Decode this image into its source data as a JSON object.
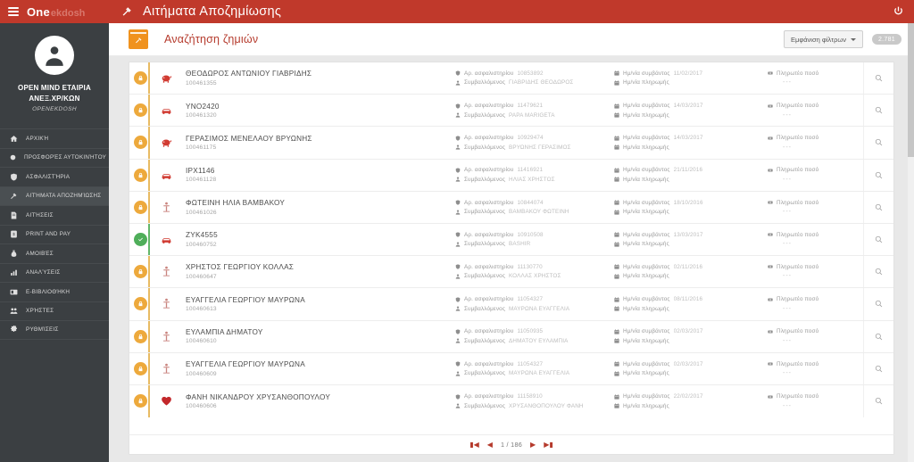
{
  "topbar": {
    "brand_main": "One",
    "brand_sub": "ekdosh",
    "menu_icon": "hamburger-icon",
    "title_icon": "gavel-icon",
    "title": "Αιτήματα Αποζημίωσης",
    "power_icon": "power-icon"
  },
  "sidebar": {
    "avatar_icon": "user-avatar-icon",
    "org_name": "OPEN MIND ΕΤΑΙΡΙΑ ΑΝΕΞ.ΧΡ/ΚΩΝ",
    "org_sub": "OPENEKDOSH",
    "items": [
      {
        "label": "Αρχική",
        "icon": "home-icon",
        "active": false
      },
      {
        "label": "Προσφορές Αυτοκινήτου",
        "icon": "circle-icon",
        "active": false
      },
      {
        "label": "Ασφαλιστήρια",
        "icon": "shield-icon",
        "active": false
      },
      {
        "label": "Αιτήματα Αποζημίωσης",
        "icon": "gavel-icon",
        "active": true
      },
      {
        "label": "Αιτήσεις",
        "icon": "document-icon",
        "active": false
      },
      {
        "label": "Print and Pay",
        "icon": "print-pay-icon",
        "active": false
      },
      {
        "label": "Αμοιβές",
        "icon": "money-bag-icon",
        "active": false
      },
      {
        "label": "Αναλύσεις",
        "icon": "chart-icon",
        "active": false
      },
      {
        "label": "e-Βιβλιοθήκη",
        "icon": "library-icon",
        "active": false
      },
      {
        "label": "Χρήστες",
        "icon": "users-icon",
        "active": false
      },
      {
        "label": "Ρυθμίσεις",
        "icon": "gear-icon",
        "active": false
      }
    ]
  },
  "page": {
    "icon": "claim-box-icon",
    "title": "Αναζήτηση ζημιών",
    "filter_button": "Εμφάνιση φίλτρων",
    "filter_caret_icon": "chevron-down-icon",
    "result_count": "2.781"
  },
  "labels": {
    "policy": "Αρ. ασφαλιστηρίου",
    "contractor": "Συμβαλλόμενος",
    "event_date": "Ημ/νία συμβάντος",
    "payment_date": "Ημ/νία πληρωμής",
    "paid_amount": "Πληρωτέο ποσό",
    "empty_value": "---",
    "policy_icon": "shield-icon",
    "contractor_icon": "person-icon",
    "date_icon": "calendar-icon",
    "amount_icon": "money-icon",
    "zoom_icon": "magnifier-icon"
  },
  "rows": [
    {
      "status": "pending",
      "status_icon": "lock-icon",
      "type_icon": "piggy-bank-icon",
      "name": "ΘΕΟΔΩΡΟΣ ΑΝΤΩΝΙΟΥ ΓΙΑΒΡΙΔΗΣ",
      "claim_id": "100461355",
      "policy": "10853892",
      "contractor": "ΓΙΑΒΡΙΔΗΣ ΘΕΟΔΩΡΟΣ",
      "event_date": "11/02/2017",
      "payment_date": "",
      "amount": "---"
    },
    {
      "status": "pending",
      "status_icon": "lock-icon",
      "type_icon": "car-icon",
      "name": "ΥΝΟ2420",
      "claim_id": "100461320",
      "policy": "11479621",
      "contractor": "PAPA MARIGETA",
      "event_date": "14/03/2017",
      "payment_date": "",
      "amount": "---"
    },
    {
      "status": "pending",
      "status_icon": "lock-icon",
      "type_icon": "piggy-bank-icon",
      "name": "ΓΕΡΑΣΙΜΟΣ ΜΕΝΕΛΑΟΥ ΒΡΥΩΝΗΣ",
      "claim_id": "100461175",
      "policy": "10929474",
      "contractor": "ΒΡΥΩΝΗΣ ΓΕΡΑΣΙΜΟΣ",
      "event_date": "14/03/2017",
      "payment_date": "",
      "amount": "---"
    },
    {
      "status": "pending",
      "status_icon": "lock-icon",
      "type_icon": "car-icon",
      "name": "ΙΡΧ1146",
      "claim_id": "100461128",
      "policy": "11416921",
      "contractor": "ΗΛΙΑΣ ΧΡΗΣΤΟΣ",
      "event_date": "21/11/2016",
      "payment_date": "",
      "amount": "---"
    },
    {
      "status": "pending",
      "status_icon": "lock-icon",
      "type_icon": "person-health-icon",
      "name": "ΦΩΤΕΙΝΗ ΗΛΙΑ ΒΑΜΒΑΚΟΥ",
      "claim_id": "100461026",
      "policy": "10844074",
      "contractor": "ΒΑΜΒΑΚΟΥ ΦΩΤΕΙΝΗ",
      "event_date": "18/10/2016",
      "payment_date": "",
      "amount": "---"
    },
    {
      "status": "done",
      "status_icon": "check-icon",
      "type_icon": "car-icon",
      "name": "ΖΥΚ4555",
      "claim_id": "100460752",
      "policy": "10910508",
      "contractor": "BASHIR",
      "event_date": "13/03/2017",
      "payment_date": "",
      "amount": "---"
    },
    {
      "status": "pending",
      "status_icon": "lock-icon",
      "type_icon": "person-health-icon",
      "name": "ΧΡΗΣΤΟΣ ΓΕΩΡΓΙΟΥ ΚΟΛΛΑΣ",
      "claim_id": "100460647",
      "policy": "11130770",
      "contractor": "ΚΟΛΛΑΣ ΧΡΗΣΤΟΣ",
      "event_date": "02/11/2016",
      "payment_date": "",
      "amount": "---"
    },
    {
      "status": "pending",
      "status_icon": "lock-icon",
      "type_icon": "person-health-icon",
      "name": "ΕΥΑΓΓΕΛΙΑ ΓΕΩΡΓΙΟΥ ΜΑΥΡΩΝΑ",
      "claim_id": "100460613",
      "policy": "11054327",
      "contractor": "ΜΑΥΡΩΝΑ ΕΥΑΓΓΕΛΙΑ",
      "event_date": "08/11/2016",
      "payment_date": "",
      "amount": "---"
    },
    {
      "status": "pending",
      "status_icon": "lock-icon",
      "type_icon": "person-health-icon",
      "name": "ΕΥΛΑΜΠΙΑ ΔΗΜΑΤΟΥ",
      "claim_id": "100460610",
      "policy": "11050935",
      "contractor": "ΔΗΜΑΤΟΥ ΕΥΛΑΜΠΙΑ",
      "event_date": "02/03/2017",
      "payment_date": "",
      "amount": "---"
    },
    {
      "status": "pending",
      "status_icon": "lock-icon",
      "type_icon": "person-health-icon",
      "name": "ΕΥΑΓΓΕΛΙΑ ΓΕΩΡΓΙΟΥ ΜΑΥΡΩΝΑ",
      "claim_id": "100460609",
      "policy": "11054327",
      "contractor": "ΜΑΥΡΩΝΑ ΕΥΑΓΓΕΛΙΑ",
      "event_date": "02/03/2017",
      "payment_date": "",
      "amount": "---"
    },
    {
      "status": "pending",
      "status_icon": "lock-icon",
      "type_icon": "heart-icon",
      "name": "ΦΑΝΗ ΝΙΚΑΝΔΡΟΥ ΧΡΥΣΑΝΘΟΠΟΥΛΟΥ",
      "claim_id": "100460606",
      "policy": "11158910",
      "contractor": "ΧΡΥΣΑΝΘΟΠΟΥΛΟΥ ΦΑΝΗ",
      "event_date": "22/02/2017",
      "payment_date": "",
      "amount": "---"
    }
  ],
  "pagination": {
    "first_icon": "first-page-icon",
    "prev_icon": "prev-page-icon",
    "info": "1 / 186",
    "next_icon": "next-page-icon",
    "last_icon": "last-page-icon"
  }
}
